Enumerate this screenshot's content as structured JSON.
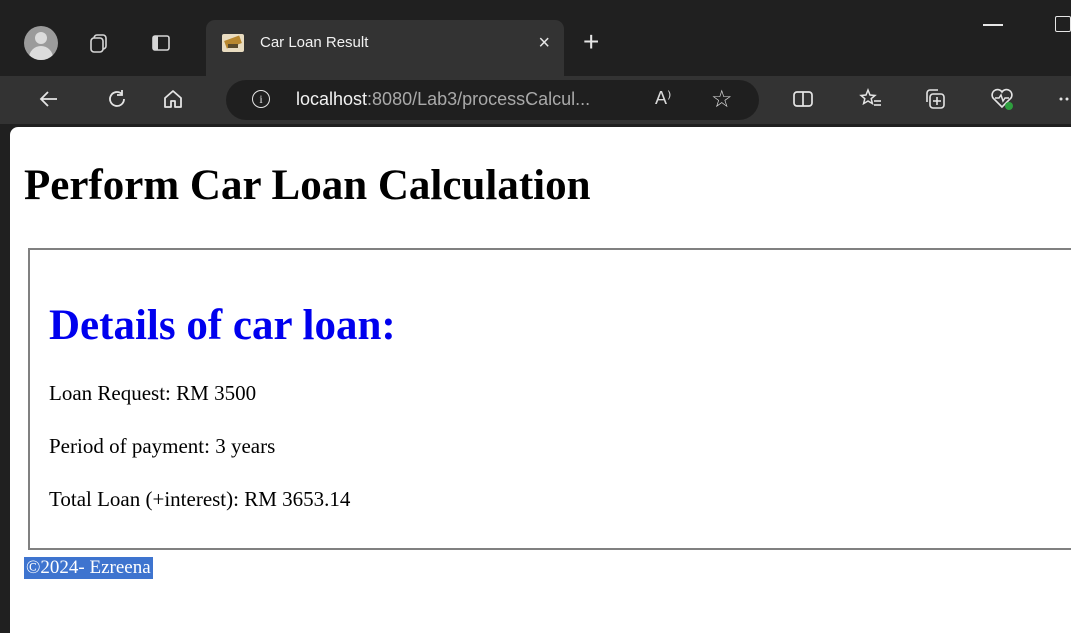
{
  "browser": {
    "tab_title": "Car Loan Result",
    "tab_close": "×",
    "new_tab": "+",
    "url_host": "localhost",
    "url_rest": ":8080/Lab3/processCalcul...",
    "read_aloud": "A⁾",
    "icons": [
      "profile-avatar",
      "workspaces-icon",
      "tab-actions-icon",
      "back-icon",
      "refresh-icon",
      "home-icon",
      "info-icon",
      "read-aloud-icon",
      "favorite-star-icon",
      "split-screen-icon",
      "favorites-icon",
      "collections-icon",
      "browser-essentials-icon",
      "more-icon"
    ]
  },
  "page": {
    "heading": "Perform Car Loan Calculation",
    "details_title": "Details of car loan:",
    "loan_request": "Loan Request: RM 3500",
    "period": "Period of payment: 3 years",
    "total": "Total Loan (+interest): RM 3653.14",
    "footer": "©2024- Ezreena"
  },
  "colors": {
    "chrome_dark": "#202020",
    "toolbar": "#333333",
    "link_blue": "#0000ee",
    "selection": "#3e74cf"
  }
}
